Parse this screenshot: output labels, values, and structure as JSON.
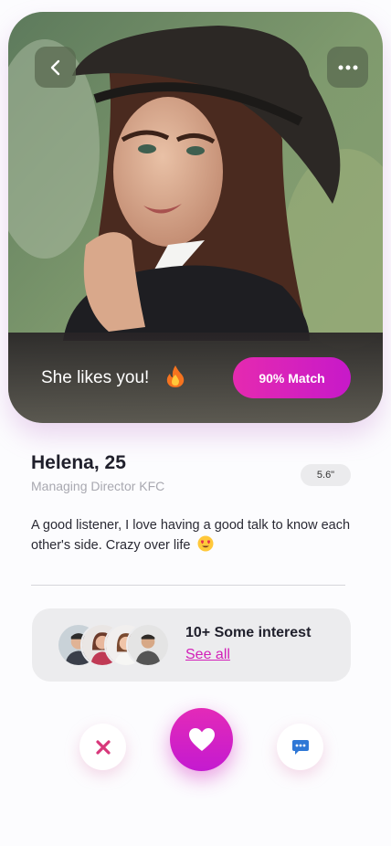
{
  "profile_card": {
    "likes_text": "She likes you!",
    "match_label": "90% Match"
  },
  "profile": {
    "name": "Helena, 25",
    "job": "Managing Director KFC",
    "height": "5.6\"",
    "bio": "A good listener, I love having a good talk to know each other's side. Crazy over life"
  },
  "interests": {
    "title": "10+ Some interest",
    "see_all": "See all"
  },
  "colors": {
    "accent": "#d21fb8",
    "match_gradient_start": "#e52ab0",
    "match_gradient_end": "#c719c9",
    "dislike": "#d8377a",
    "chat": "#2f78d6"
  },
  "icons": {
    "back": "chevron-left-icon",
    "more": "more-horizontal-icon",
    "fire": "fire-icon",
    "emoji": "heart-eyes-emoji-icon",
    "dislike": "close-icon",
    "like": "heart-icon",
    "chat": "chat-bubble-icon"
  }
}
